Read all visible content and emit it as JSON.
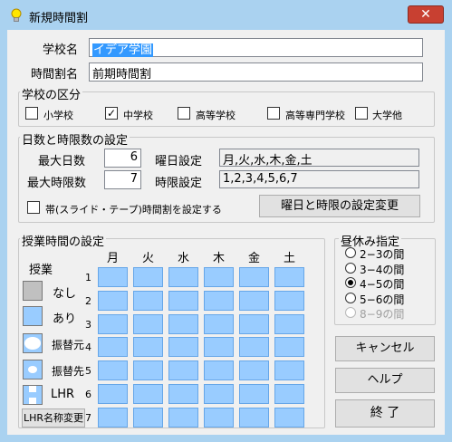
{
  "window": {
    "title": "新規時間割",
    "title_icon": "lightbulb-icon",
    "close_symbol": "✕"
  },
  "school": {
    "name_label": "学校名",
    "name_value": "イデア学園",
    "timetable_label": "時間割名",
    "timetable_value": "前期時間割"
  },
  "school_type": {
    "title": "学校の区分",
    "options": [
      {
        "label": "小学校",
        "checked": false
      },
      {
        "label": "中学校",
        "checked": true
      },
      {
        "label": "高等学校",
        "checked": false
      },
      {
        "label": "高等専門学校",
        "checked": false
      },
      {
        "label": "大学他",
        "checked": false
      }
    ]
  },
  "days_periods": {
    "title": "日数と時限数の設定",
    "max_days_label": "最大日数",
    "max_days_value": "6",
    "max_periods_label": "最大時限数",
    "max_periods_value": "7",
    "weekday_setting_label": "曜日設定",
    "weekday_setting_value": "月,火,水,木,金,土",
    "period_setting_label": "時限設定",
    "period_setting_value": "1,2,3,4,5,6,7",
    "strip_checkbox_label": "帯(スライド・テープ)時間割を設定する",
    "strip_checked": false,
    "change_button": "曜日と時限の設定変更"
  },
  "class_time": {
    "title": "授業時間の設定",
    "days": [
      "月",
      "火",
      "水",
      "木",
      "金",
      "土"
    ],
    "periods": [
      "1",
      "2",
      "3",
      "4",
      "5",
      "6",
      "7"
    ],
    "legend_title": "授業",
    "legend": {
      "none": "なし",
      "yes": "あり",
      "swap_from": "振替元",
      "swap_to": "振替先",
      "lhr": "LHR"
    },
    "lhr_rename_button": "LHR名称変更",
    "colors": {
      "on": "#99ccff",
      "off": "#c0c0c0"
    }
  },
  "lunch": {
    "title": "昼休み指定",
    "options": [
      {
        "label": "2−3の間",
        "checked": false,
        "disabled": false
      },
      {
        "label": "3−4の間",
        "checked": false,
        "disabled": false
      },
      {
        "label": "4−5の間",
        "checked": true,
        "disabled": false
      },
      {
        "label": "5−6の間",
        "checked": false,
        "disabled": false
      },
      {
        "label": "8−9の間",
        "checked": false,
        "disabled": true
      }
    ]
  },
  "buttons": {
    "cancel": "キャンセル",
    "help": "ヘルプ",
    "finish": "終 了"
  }
}
